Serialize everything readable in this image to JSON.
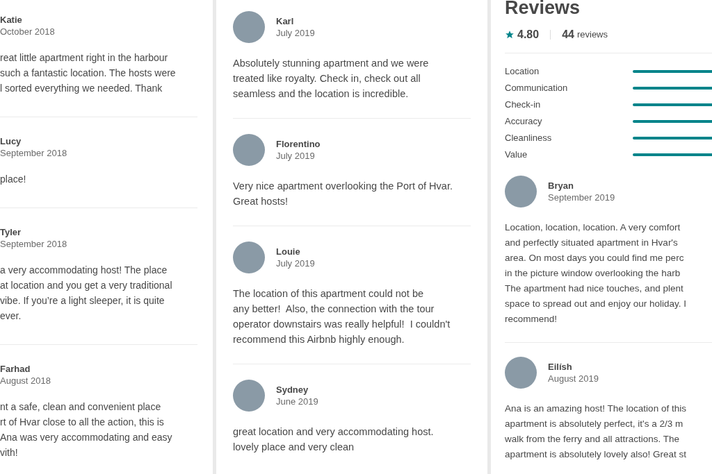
{
  "panels": [
    {
      "reviews": [
        {
          "name": "Katie",
          "date": "October 2018",
          "avatar": false,
          "lines": [
            "reat little apartment right in the harbour",
            "such a fantastic location. The hosts were",
            "l sorted everything we needed. Thank"
          ]
        },
        {
          "name": "Lucy",
          "date": "September 2018",
          "avatar": false,
          "lines": [
            "place!"
          ]
        },
        {
          "name": "Tyler",
          "date": "September 2018",
          "avatar": false,
          "lines": [
            "a very accommodating host! The place",
            "at location and you get a very traditional",
            "vibe. If you’re a light sleeper, it is quite",
            "ever."
          ]
        },
        {
          "name": "Farhad",
          "date": "August 2018",
          "avatar": false,
          "lines": [
            "nt a safe, clean and convenient place",
            "rt of Hvar close to all the action, this is",
            "Ana was very accommodating and easy",
            "vith!"
          ]
        }
      ]
    },
    {
      "reviews": [
        {
          "name": "Karl",
          "date": "July 2019",
          "avatar": true,
          "lines": [
            "Absolutely stunning apartment and we were",
            "treated like royalty. Check in, check out all",
            "seamless and the location is incredible."
          ]
        },
        {
          "name": "Florentino",
          "date": "July 2019",
          "avatar": true,
          "lines": [
            "Very nice apartment overlooking the Port of Hvar.",
            "Great hosts!"
          ]
        },
        {
          "name": "Louie",
          "date": "July 2019",
          "avatar": true,
          "lines": [
            "The location of this apartment could not be",
            "any better!  Also, the connection with the tour",
            "operator downstairs was really helpful!  I couldn't",
            "recommend this Airbnb highly enough."
          ]
        },
        {
          "name": "Sydney",
          "date": "June 2019",
          "avatar": true,
          "lines": [
            "great location and very accommodating host.",
            "lovely place and very clean"
          ]
        }
      ]
    },
    {
      "title": "Reviews",
      "rating": "4.80",
      "count": "44",
      "count_label": "reviews",
      "categories": [
        "Location",
        "Communication",
        "Check-in",
        "Accuracy",
        "Cleanliness",
        "Value"
      ],
      "reviews": [
        {
          "name": "Bryan",
          "date": "September 2019",
          "avatar": true,
          "lines": [
            "Location, location, location. A very comfort",
            "and perfectly situated apartment in Hvar's",
            "area. On most days you could find me perc",
            "in the picture window overlooking the harb",
            "The apartment had nice touches, and plent",
            "space to spread out and enjoy our holiday. I",
            "recommend!"
          ]
        },
        {
          "name": "Eilísh",
          "date": "August 2019",
          "avatar": true,
          "lines": [
            "Ana is an amazing host! The location of this",
            "apartment is absolutely perfect, it's a 2/3 m",
            "walk from the ferry and all attractions. The",
            "apartment is absolutely lovely also! Great st"
          ]
        }
      ]
    }
  ]
}
